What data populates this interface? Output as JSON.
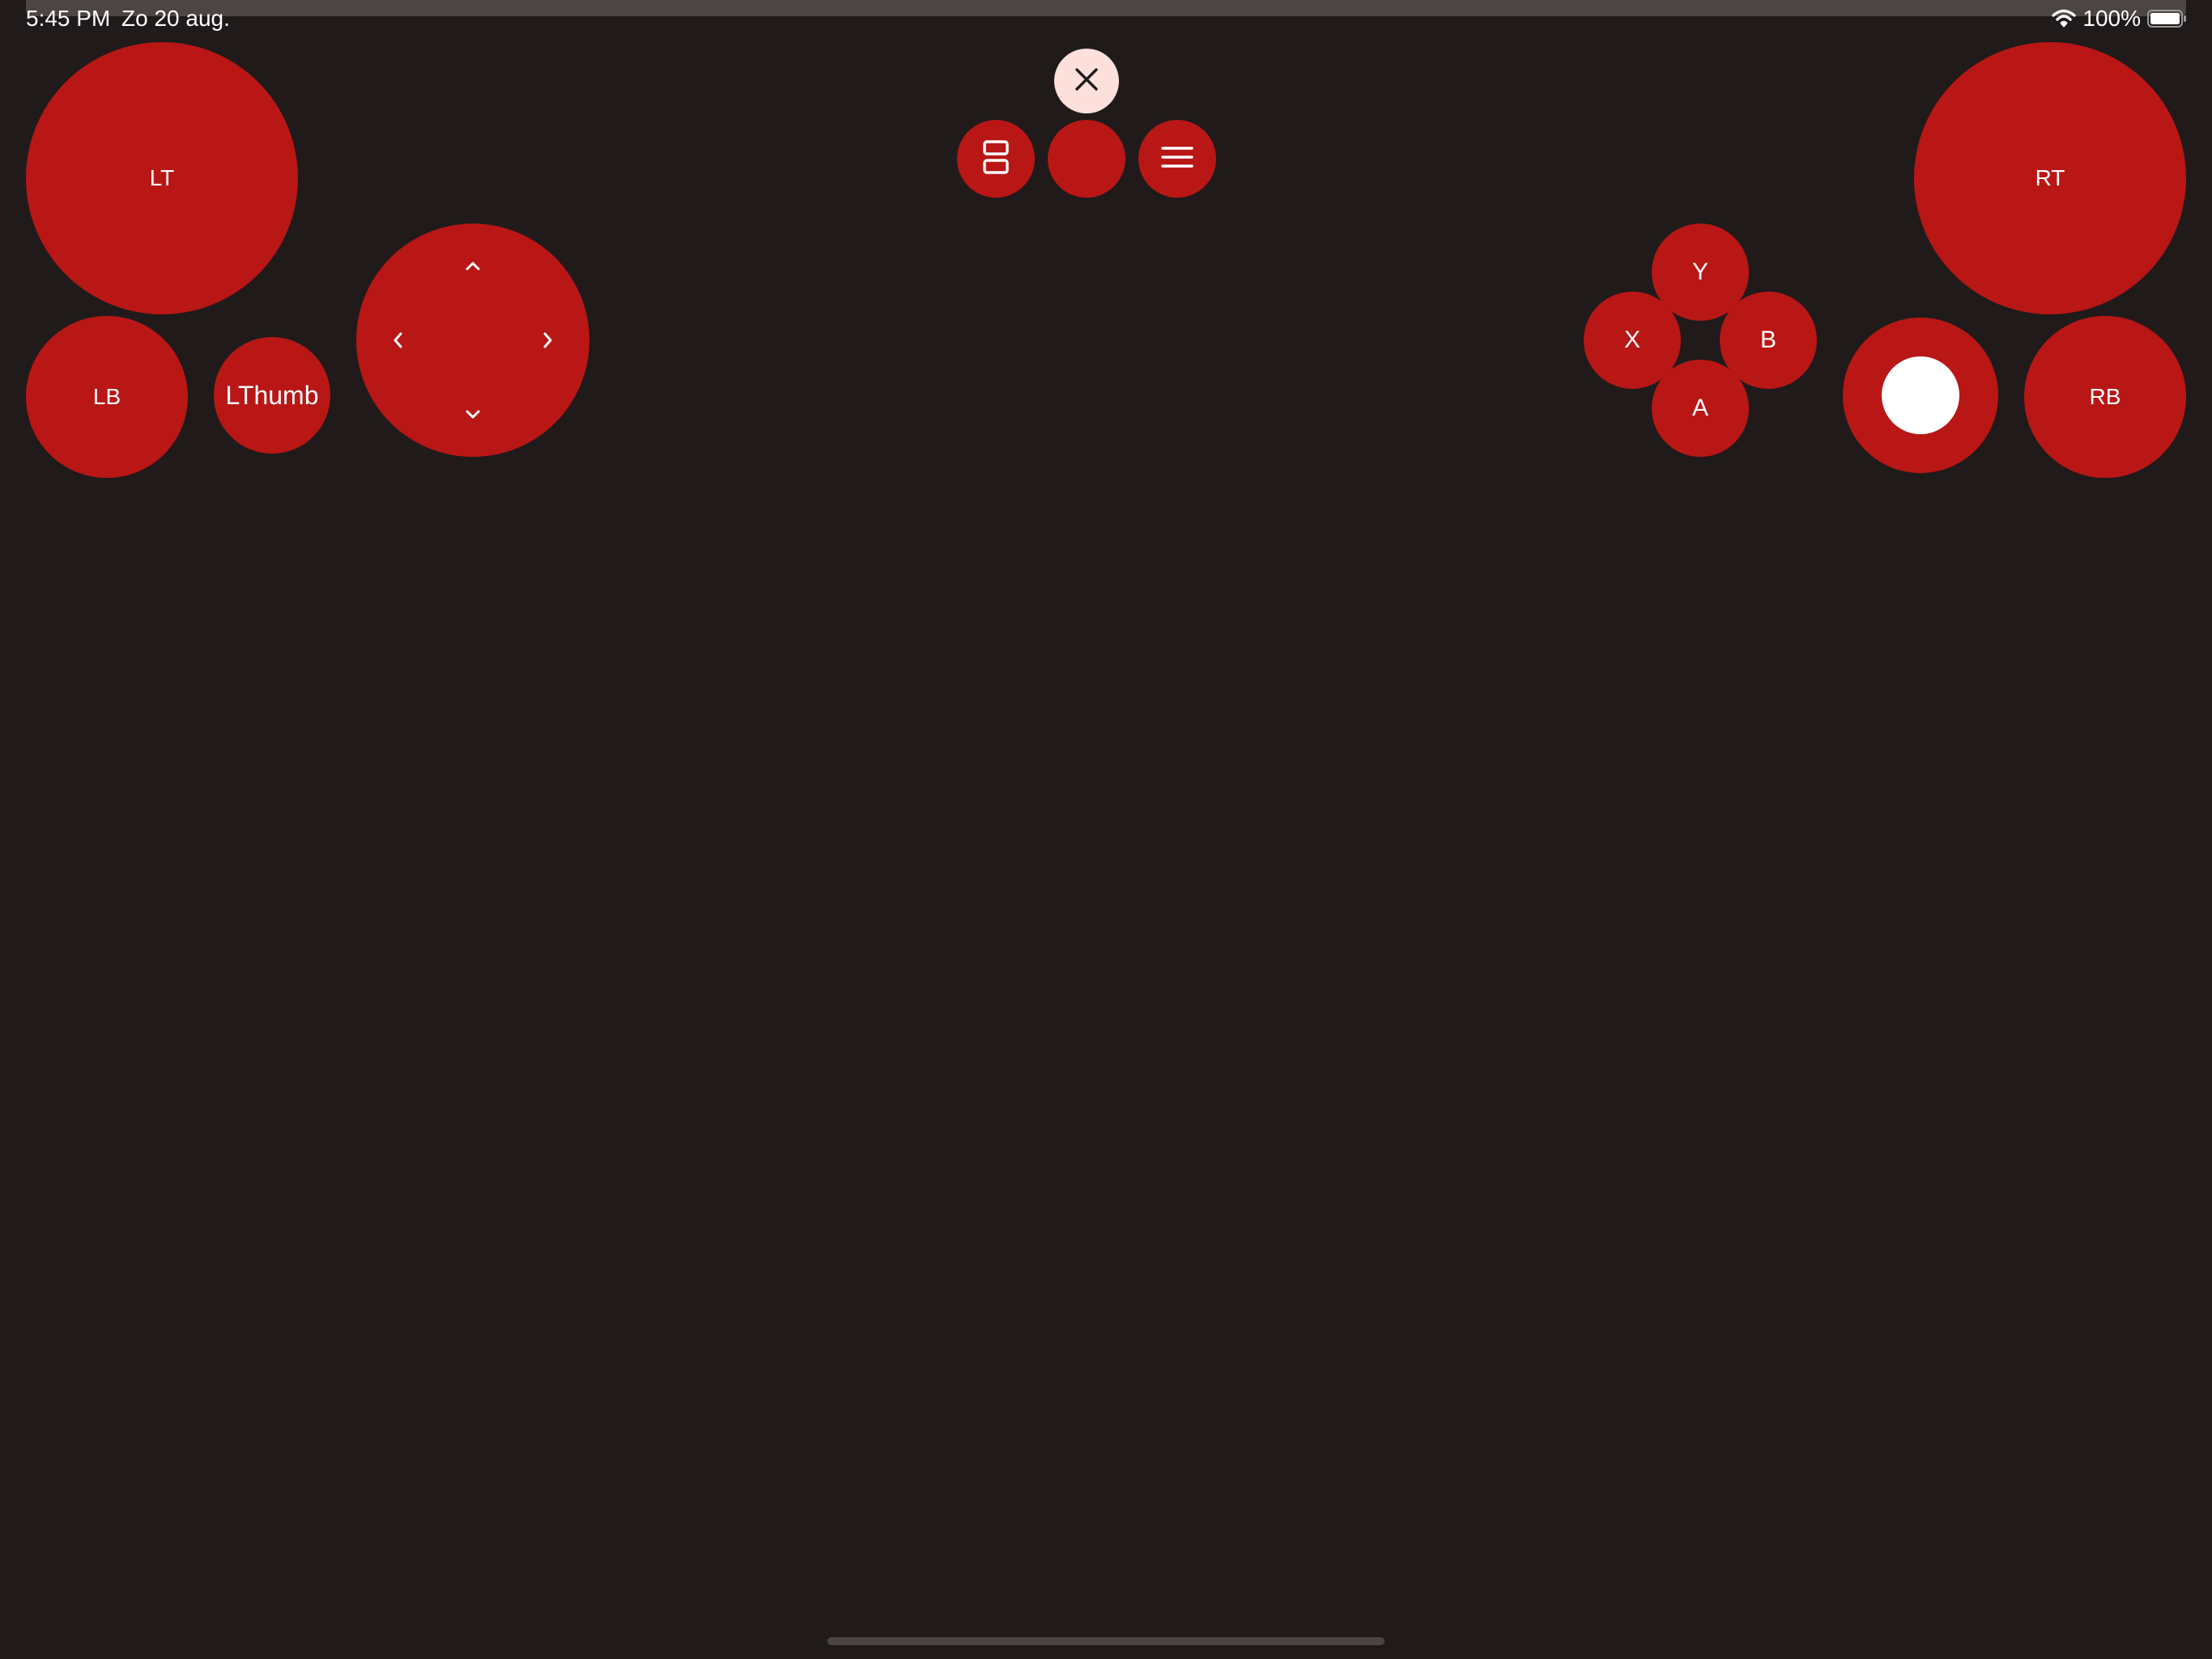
{
  "status_bar": {
    "time": "5:45 PM",
    "date": "Zo 20 aug.",
    "battery": "100%",
    "wifi_icon": "wifi-icon",
    "battery_icon": "battery-full-icon"
  },
  "controls": {
    "lt": "LT",
    "rt": "RT",
    "lb": "LB",
    "rb": "RB",
    "lthumb": "LThumb",
    "y": "Y",
    "x": "X",
    "b": "B",
    "a": "A"
  },
  "toolbar": {
    "close_icon": "close-icon",
    "view_icon": "view-icon",
    "menu_icon": "menu-icon"
  },
  "colors": {
    "background": "#201b1a",
    "button": "#b91616",
    "close_button": "#fde0dc"
  }
}
